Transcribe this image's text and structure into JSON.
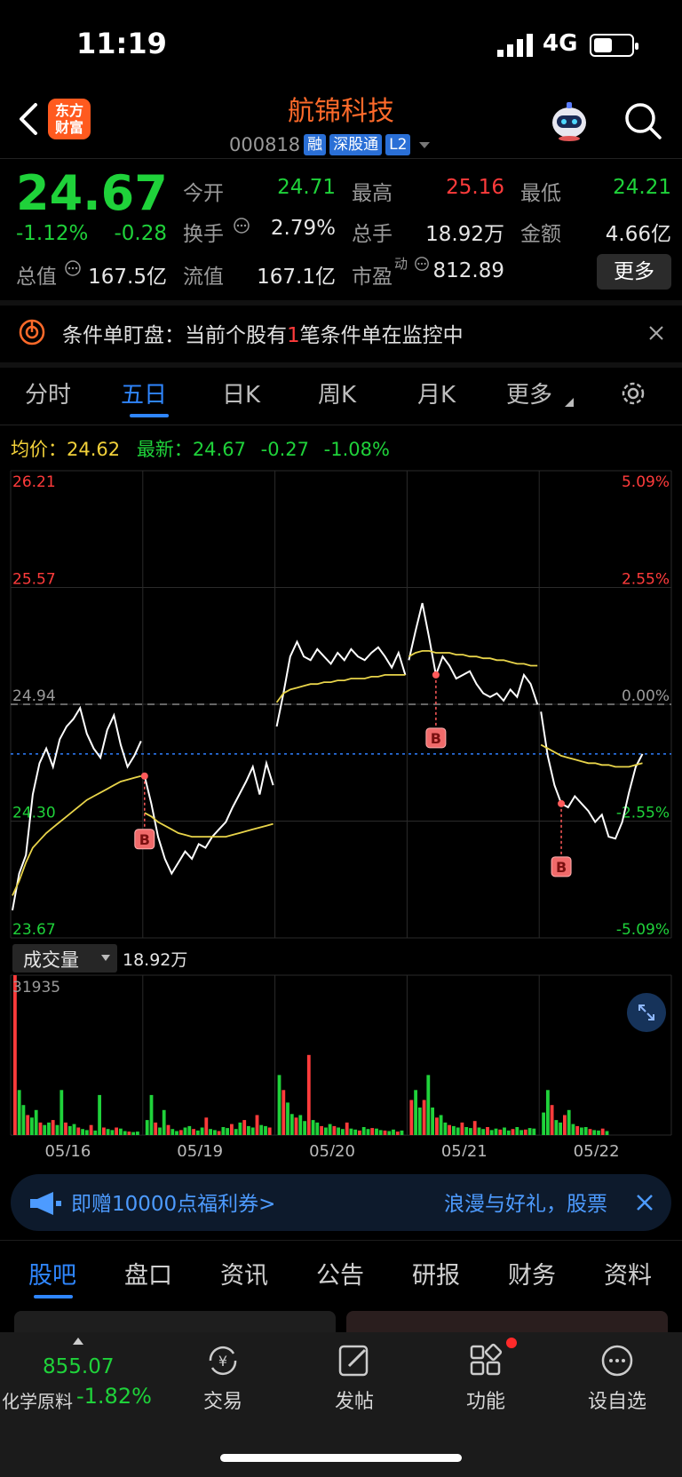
{
  "status_bar": {
    "time": "11:19",
    "network": "4G"
  },
  "header": {
    "logo_text_1": "东方",
    "logo_text_2": "财富",
    "stock_name": "航锦科技",
    "stock_code": "000818",
    "tags": [
      "融",
      "深股通",
      "L2"
    ]
  },
  "quote": {
    "price": "24.67",
    "change_pct": "-1.12%",
    "change": "-0.28",
    "open_label": "今开",
    "open": "24.71",
    "high_label": "最高",
    "high": "25.16",
    "low_label": "最低",
    "low": "24.21",
    "turnover_label": "换手",
    "turnover": "2.79%",
    "volume_label": "总手",
    "volume": "18.92万",
    "amount_label": "金额",
    "amount": "4.66亿",
    "mktcap_label": "总值",
    "mktcap": "167.5亿",
    "float_label": "流值",
    "float_cap": "167.1亿",
    "pe_label": "市盈",
    "pe_sup": "动",
    "pe": "812.89",
    "more_button": "更多"
  },
  "alert": {
    "prefix": "条件单盯盘：当前个股有",
    "count": "1",
    "suffix": "笔条件单在监控中"
  },
  "chart_tabs": [
    "分时",
    "五日",
    "日K",
    "周K",
    "月K",
    "更多"
  ],
  "chart_info": {
    "avg_label": "均价：",
    "avg": "24.62",
    "last_label": "最新：",
    "last": "24.67",
    "last_change": "-0.27",
    "last_pct": "-1.08%"
  },
  "volume_panel": {
    "selector_label": "成交量",
    "total": "18.92万",
    "max_tick": "31935"
  },
  "chart_data": {
    "type": "line",
    "price_axis_left": [
      "26.21",
      "25.57",
      "24.94",
      "24.30",
      "23.67"
    ],
    "pct_axis_right": [
      "5.09%",
      "2.55%",
      "0.00%",
      "-2.55%",
      "-5.09%"
    ],
    "ylim": [
      23.67,
      26.21
    ],
    "prev_close": 24.94,
    "last_price": 24.67,
    "days": [
      "05/16",
      "05/19",
      "05/20",
      "05/21",
      "05/22"
    ],
    "buy_marker_label": "B",
    "series": [
      {
        "values": [
          [
            23.82,
            24.02,
            24.12,
            24.45,
            24.62,
            24.7,
            24.6,
            24.75,
            24.82,
            24.86,
            24.92,
            24.78,
            24.7,
            24.65,
            24.8,
            24.88,
            24.72,
            24.6,
            24.66,
            24.74
          ],
          [
            24.55,
            24.4,
            24.22,
            24.1,
            24.02,
            24.08,
            24.14,
            24.1,
            24.18,
            24.16,
            24.22,
            24.26,
            24.3,
            24.38,
            24.45,
            24.52,
            24.6,
            24.45,
            24.62,
            24.5
          ],
          [
            24.82,
            25.0,
            25.2,
            25.28,
            25.2,
            25.18,
            25.24,
            25.2,
            25.16,
            25.22,
            25.18,
            25.24,
            25.2,
            25.18,
            25.22,
            25.25,
            25.2,
            25.14,
            25.22,
            25.1
          ],
          [
            25.18,
            25.34,
            25.49,
            25.3,
            25.1,
            25.2,
            25.15,
            25.08,
            25.1,
            25.12,
            25.05,
            25.0,
            24.98,
            25.0,
            24.96,
            25.02,
            24.98,
            25.1,
            25.05,
            24.94
          ],
          [
            24.9,
            24.66,
            24.5,
            24.4,
            24.38,
            24.44,
            24.4,
            24.36,
            24.3,
            24.34,
            24.22,
            24.21,
            24.3,
            24.46,
            24.6,
            24.67
          ]
        ]
      },
      {
        "name": "均价",
        "values": [
          [
            23.9,
            23.98,
            24.08,
            24.16,
            24.2,
            24.24,
            24.27,
            24.3,
            24.33,
            24.36,
            24.39,
            24.42,
            24.44,
            24.46,
            24.48,
            24.5,
            24.52,
            24.53,
            24.54,
            24.55
          ],
          [
            24.35,
            24.33,
            24.3,
            24.28,
            24.26,
            24.24,
            24.23,
            24.22,
            24.22,
            24.22,
            24.22,
            24.22,
            24.22,
            24.23,
            24.24,
            24.25,
            24.26,
            24.27,
            24.28,
            24.29
          ],
          [
            24.95,
            25.0,
            25.02,
            25.03,
            25.04,
            25.05,
            25.05,
            25.06,
            25.06,
            25.07,
            25.07,
            25.08,
            25.08,
            25.08,
            25.09,
            25.09,
            25.1,
            25.1,
            25.1,
            25.1
          ],
          [
            25.2,
            25.22,
            25.23,
            25.23,
            25.22,
            25.22,
            25.22,
            25.21,
            25.21,
            25.2,
            25.2,
            25.19,
            25.19,
            25.18,
            25.18,
            25.17,
            25.16,
            25.16,
            25.15,
            25.15
          ],
          [
            24.72,
            24.7,
            24.68,
            24.66,
            24.65,
            24.64,
            24.63,
            24.62,
            24.62,
            24.61,
            24.61,
            24.6,
            24.6,
            24.6,
            24.61,
            24.62
          ]
        ]
      }
    ],
    "volume_max": 31935,
    "volume": {
      "values": [
        [
          31935,
          9000,
          6000,
          4000,
          3500,
          5000,
          2500,
          2000,
          2500,
          3000,
          2000,
          9000,
          2500,
          1800,
          2200,
          1500,
          1200,
          1000,
          2000,
          900,
          8000,
          1500,
          1200,
          1000,
          1500,
          1300,
          800,
          700,
          600,
          700
        ],
        [
          3000,
          8000,
          2500,
          1500,
          5000,
          2000,
          1200,
          800,
          1000,
          1500,
          1800,
          1200,
          900,
          1500,
          3500,
          1200,
          1000,
          800,
          1600,
          1400,
          2200,
          1200,
          2500,
          3000,
          1800,
          1500,
          4000,
          2000,
          1800,
          1500
        ],
        [
          12000,
          9000,
          6500,
          4200,
          3500,
          4000,
          2800,
          16000,
          3000,
          2500,
          1800,
          1500,
          2200,
          1800,
          1500,
          1200,
          2500,
          1300,
          1100,
          900,
          1600,
          1200,
          1400,
          1300,
          1000,
          900,
          800,
          1100,
          700,
          900
        ],
        [
          7000,
          9000,
          5500,
          7000,
          12000,
          5500,
          3500,
          4000,
          2500,
          2000,
          1800,
          1500,
          2500,
          1600,
          1400,
          2800,
          1500,
          1200,
          1600,
          1000,
          1300,
          1100,
          1500,
          900,
          1200,
          1600,
          1000,
          1100,
          1400,
          1300
        ],
        [
          4500,
          9000,
          6000,
          3000,
          2500,
          4000,
          5000,
          2200,
          1800,
          1500,
          1600,
          1200,
          1000,
          900,
          1300,
          800
        ]
      ]
    }
  },
  "banner": {
    "left_text": "即赠10000点福利券>",
    "right_text": "浪漫与好礼，股票"
  },
  "bottom_tabs": [
    "股吧",
    "盘口",
    "资讯",
    "公告",
    "研报",
    "财务",
    "资料"
  ],
  "bottom_nav": {
    "index_value": "855.07",
    "index_name": "化学原料",
    "index_pct": "-1.82%",
    "items": [
      "交易",
      "发帖",
      "功能",
      "设自选"
    ]
  }
}
